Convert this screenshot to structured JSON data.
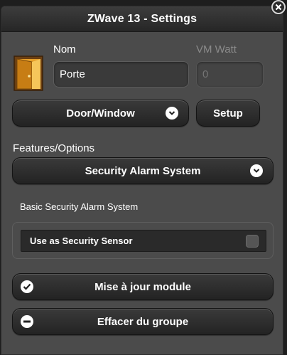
{
  "window": {
    "title": "ZWave 13 - Settings"
  },
  "fields": {
    "nom": {
      "label": "Nom",
      "value": "Porte"
    },
    "vm_watt": {
      "label": "VM Watt",
      "placeholder": "0"
    }
  },
  "device_type": {
    "label": "Door/Window"
  },
  "setup": {
    "label": "Setup"
  },
  "features": {
    "label": "Features/Options",
    "selected": "Security Alarm System",
    "description": "Basic Security Alarm System"
  },
  "sensor": {
    "label": "Use as Security Sensor"
  },
  "actions": {
    "update_label": "Mise à jour module",
    "remove_label": "Effacer du groupe"
  },
  "icons": {
    "close": "close-icon",
    "door": "door-icon",
    "chevron": "chevron-down-icon",
    "check": "check-icon",
    "minus": "minus-icon"
  },
  "colors": {
    "background": "#4b4b4b",
    "titlebar": "#262626",
    "button": "#2d2d2d"
  }
}
